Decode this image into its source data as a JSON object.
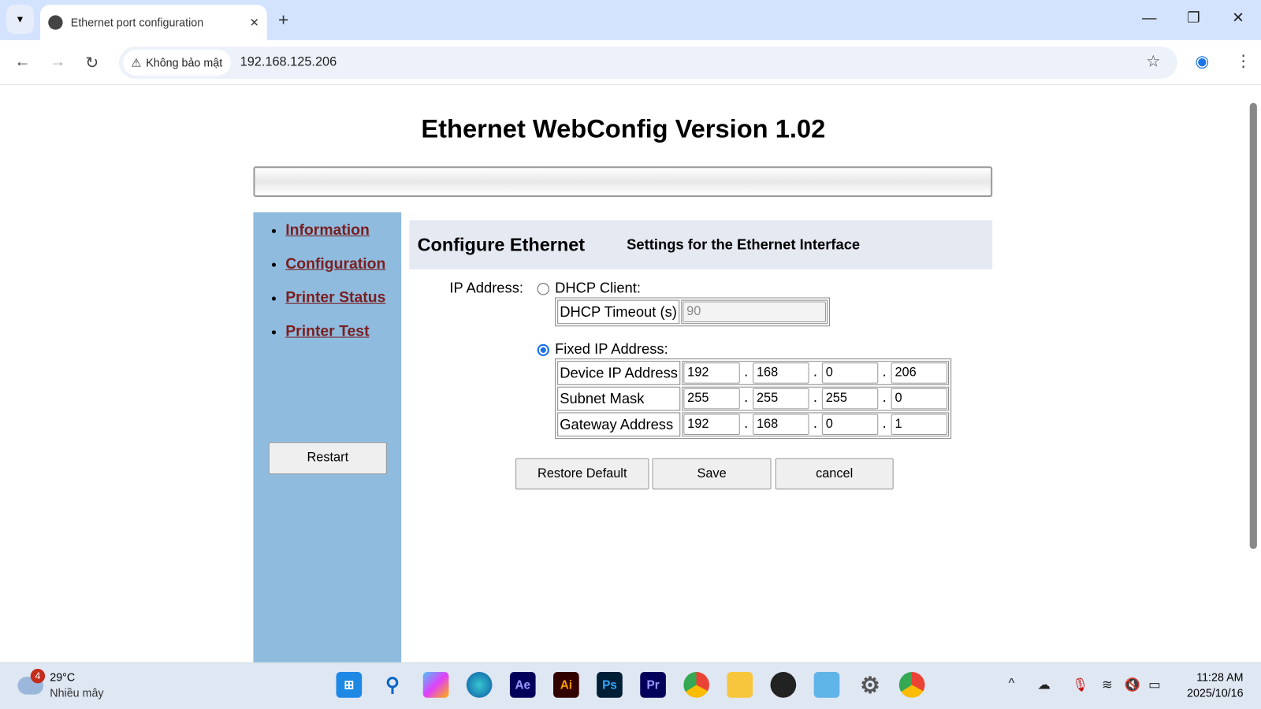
{
  "browser": {
    "tab_title": "Ethernet port configuration",
    "security_chip": "Không bảo mật",
    "url": "192.168.125.206"
  },
  "page": {
    "title": "Ethernet WebConfig Version 1.02",
    "sidebar": {
      "links": [
        "Information",
        "Configuration",
        "Printer Status",
        "Printer Test"
      ],
      "restart": "Restart"
    },
    "section_title": "Configure Ethernet",
    "section_subtitle": "Settings for the Ethernet Interface",
    "ip_label": "IP Address:",
    "dhcp_label": "DHCP Client:",
    "dhcp_selected": false,
    "dhcp_timeout_label": "DHCP Timeout (s)",
    "dhcp_timeout": "90",
    "fixed_label": "Fixed IP Address:",
    "fixed_selected": true,
    "rows": [
      {
        "label": "Device IP Address",
        "octets": [
          "192",
          "168",
          "0",
          "206"
        ]
      },
      {
        "label": "Subnet Mask",
        "octets": [
          "255",
          "255",
          "255",
          "0"
        ]
      },
      {
        "label": "Gateway Address",
        "octets": [
          "192",
          "168",
          "0",
          "1"
        ]
      }
    ],
    "buttons": {
      "restore": "Restore Default",
      "save": "Save",
      "cancel": "cancel"
    }
  },
  "taskbar": {
    "weather_temp": "29°C",
    "weather_desc": "Nhiều mây",
    "weather_badge": "4",
    "time": "11:28 AM",
    "date": "2025/10/16",
    "apps": [
      "Windows Start",
      "Search",
      "Copilot",
      "Edge",
      "Ae",
      "Ai",
      "Ps",
      "Pr",
      "Chrome",
      "File Explorer",
      "OBS",
      "Screenshot",
      "Settings",
      "Chrome"
    ]
  }
}
